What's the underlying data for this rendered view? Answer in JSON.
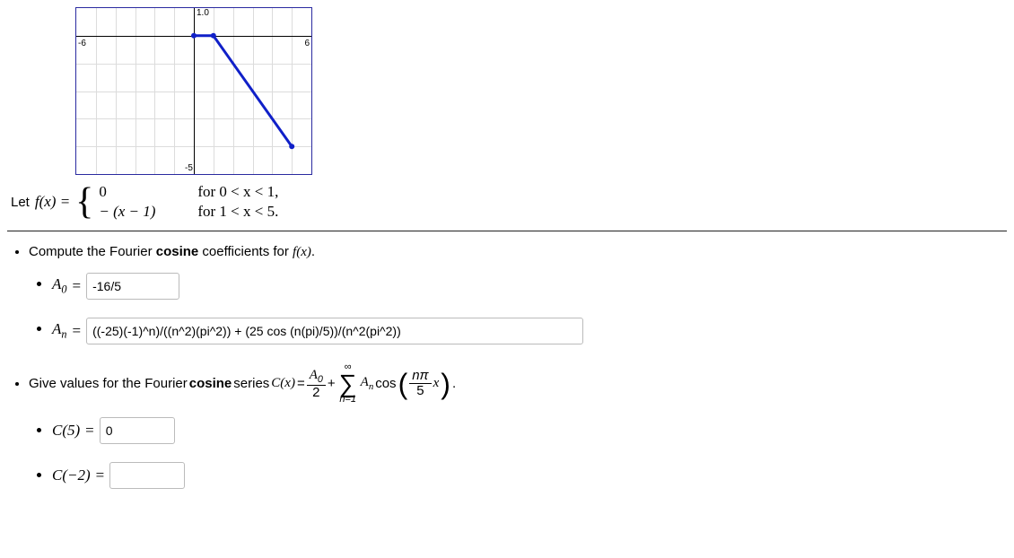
{
  "graph": {
    "xmin_label": "-6",
    "xmax_label": "6",
    "ytop_label": "1.0",
    "ybot_label": "-5"
  },
  "piecewise": {
    "lead": "Let ",
    "fx": "f(x) = ",
    "case1_val": "0",
    "case1_cond": "for  0 < x < 1,",
    "case2_val": "− (x − 1)",
    "case2_cond": "for  1 < x < 5."
  },
  "q1": {
    "prompt_a": "Compute the Fourier ",
    "prompt_b": "cosine",
    "prompt_c": " coefficients for ",
    "fx": "f(x)",
    "A0_label": "A",
    "A0_sub": "0",
    "eq": " = ",
    "A0_value": "-16/5",
    "An_label": "A",
    "An_sub": "n",
    "An_value": "((-25)(-1)^n)/((n^2)(pi^2)) + (25 cos (n(pi)/5))/(n^2(pi^2))"
  },
  "q2": {
    "prompt_a": "Give values for the Fourier ",
    "prompt_b": "cosine",
    "prompt_c": " series ",
    "Cx": "C(x)",
    "eq": " = ",
    "frac_num": "A",
    "frac_num_sub": "0",
    "frac_den": "2",
    "plus": " + ",
    "sum_top": "∞",
    "sum_bot": "n=1",
    "An": "A",
    "An_sub": "n",
    "cos": " cos",
    "inner_num": "nπ",
    "inner_den": "5",
    "xdot": " x",
    "period": ".",
    "C5_label": "C(5)",
    "C5_value": "0",
    "Cm2_label": "C(−2)",
    "Cm2_value": ""
  },
  "chart_data": {
    "type": "line",
    "title": "",
    "xlabel": "",
    "ylabel": "",
    "xlim": [
      -6,
      6
    ],
    "ylim": [
      -5,
      1
    ],
    "series": [
      {
        "name": "f(x)",
        "x": [
          0,
          1,
          5
        ],
        "y": [
          0,
          0,
          -4
        ]
      }
    ]
  }
}
